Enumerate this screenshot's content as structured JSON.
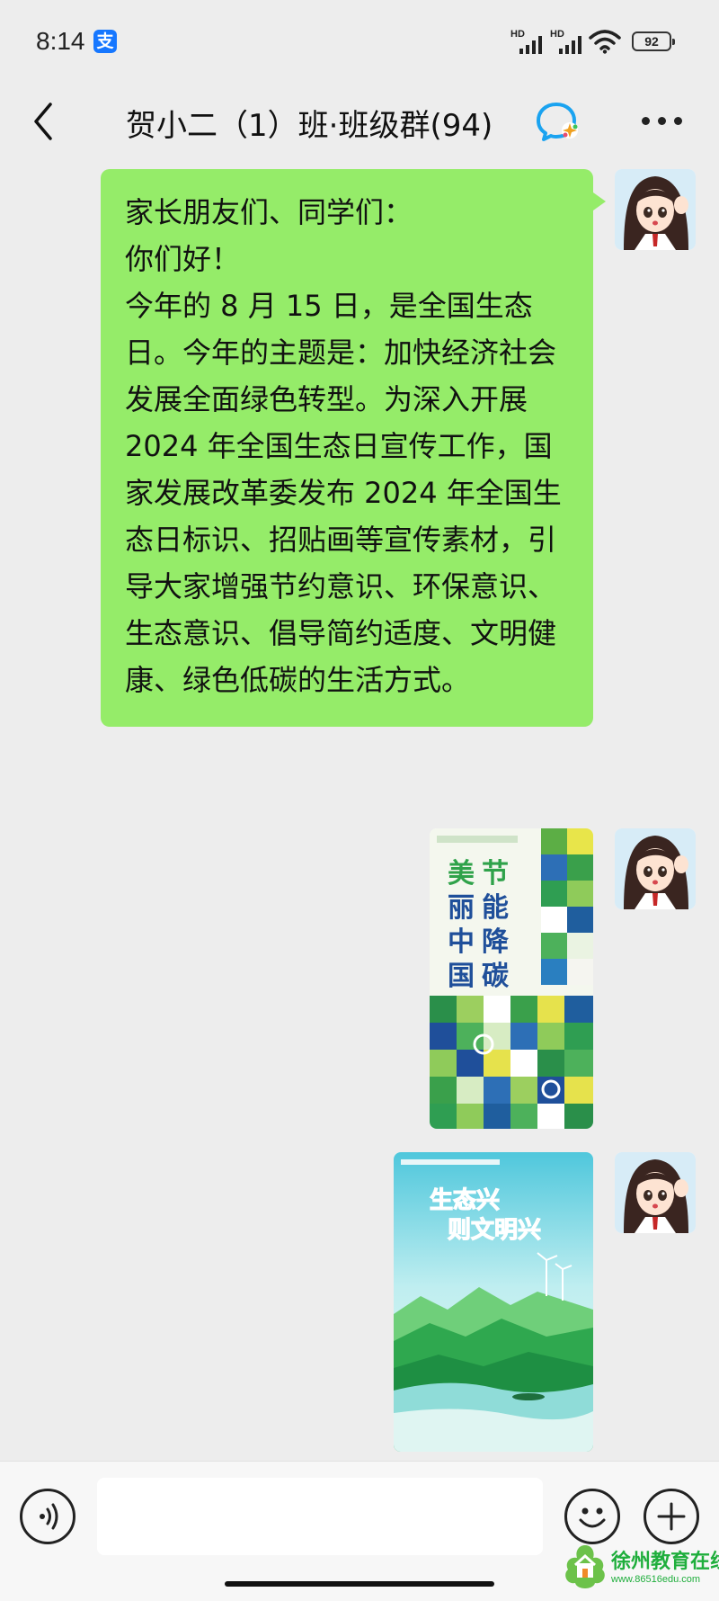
{
  "status_bar": {
    "time": "8:14",
    "alipay_icon": "支",
    "signal_1_label": "HD",
    "signal_2_label": "HD",
    "battery": "92"
  },
  "header": {
    "title": "贺小二（1）班·班级群(94)"
  },
  "messages": [
    {
      "type": "text",
      "lines": [
        "家长朋友们、同学们：",
        "你们好！",
        "今年的 8 月 15 日，是全国生态日。今年的主题是：加快经济社会发展全面绿色转型。为深入开展 2024 年全国生态日宣传工作，国家发展改革委发布 2024 年全国生态日标识、招贴画等宣传素材，引导大家增强节约意识、环保意识、生态意识、倡导简约适度、文明健康、绿色低碳的生活方式。"
      ]
    },
    {
      "type": "image",
      "poster_text": "美丽中国 节能降碳"
    },
    {
      "type": "image",
      "poster_text": "生态兴 则文明兴"
    }
  ],
  "watermark": {
    "title": "徐州教育在线",
    "url": "www.86516edu.com"
  },
  "colors": {
    "bubble": "#95ec69",
    "background": "#ededed",
    "poster_blue": "#1f4f9a",
    "poster_green": "#2fa24a"
  }
}
